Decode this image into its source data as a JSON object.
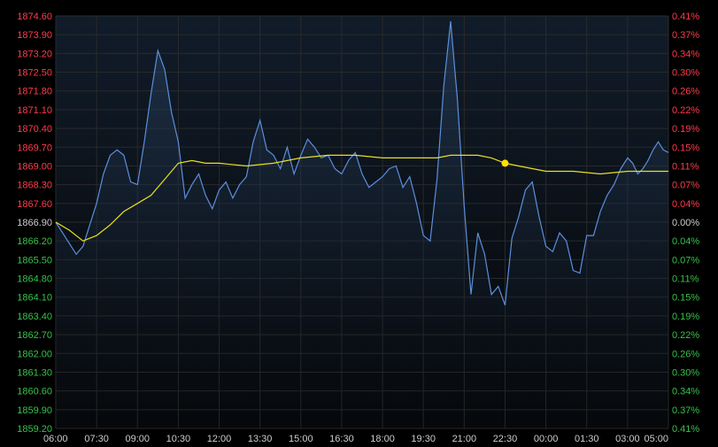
{
  "chart_data": {
    "type": "line",
    "title": "",
    "xlabel": "",
    "ylabel": "",
    "ylim": [
      1859.2,
      1874.6
    ],
    "reference_price": 1866.9,
    "grid": true,
    "legend": "none",
    "colors": {
      "background": "#000000",
      "plot_top": "#0f1b2b",
      "grid": "#2a2a2a",
      "up": "#ff3b4a",
      "down": "#35c24a",
      "neutral": "#cccccc",
      "price_line": "#5b8fdc",
      "avg_line": "#e8e020",
      "marker": "#ffe000",
      "xtick": "#cccccc"
    },
    "y_ticks_left": [
      "1874.60",
      "1873.90",
      "1873.20",
      "1872.50",
      "1871.80",
      "1871.10",
      "1870.40",
      "1869.70",
      "1869.00",
      "1868.30",
      "1867.60",
      "1866.90",
      "1866.20",
      "1865.50",
      "1864.80",
      "1864.10",
      "1863.40",
      "1862.70",
      "1862.00",
      "1861.30",
      "1860.60",
      "1859.90",
      "1859.20"
    ],
    "y_ticks_right": [
      "0.41%",
      "0.37%",
      "0.34%",
      "0.30%",
      "0.26%",
      "0.22%",
      "0.19%",
      "0.15%",
      "0.11%",
      "0.07%",
      "0.04%",
      "0.00%",
      "0.04%",
      "0.07%",
      "0.11%",
      "0.15%",
      "0.19%",
      "0.22%",
      "0.26%",
      "0.30%",
      "0.34%",
      "0.37%",
      "0.41%"
    ],
    "x_ticks": [
      "06:00",
      "07:30",
      "09:00",
      "10:30",
      "12:00",
      "13:30",
      "15:00",
      "16:30",
      "18:00",
      "19:30",
      "21:00",
      "22:30",
      "00:00",
      "01:30",
      "03:00",
      "05:00"
    ],
    "series": [
      {
        "x": [
          "06:00",
          "06:15",
          "06:30",
          "06:45",
          "07:00",
          "07:15",
          "07:30",
          "07:45",
          "08:00",
          "08:15",
          "08:30",
          "08:45",
          "09:00",
          "09:15",
          "09:30",
          "09:45",
          "10:00",
          "10:15",
          "10:30",
          "10:45",
          "11:00",
          "11:15",
          "11:30",
          "11:45",
          "12:00",
          "12:15",
          "12:30",
          "12:45",
          "13:00",
          "13:15",
          "13:30",
          "13:45",
          "14:00",
          "14:15",
          "14:30",
          "14:45",
          "15:00",
          "15:15",
          "15:30",
          "15:45",
          "16:00",
          "16:15",
          "16:30",
          "16:45",
          "17:00",
          "17:15",
          "17:30",
          "17:45",
          "18:00",
          "18:15",
          "18:30",
          "18:45",
          "19:00",
          "19:15",
          "19:30",
          "19:45",
          "20:00",
          "20:15",
          "20:30",
          "20:45",
          "21:00",
          "21:15",
          "21:30",
          "21:45",
          "22:00",
          "22:15",
          "22:30",
          "22:45",
          "23:00",
          "23:15",
          "23:30",
          "23:45",
          "00:00",
          "00:15",
          "00:30",
          "00:45",
          "01:00",
          "01:15",
          "01:30",
          "01:45",
          "02:00",
          "02:15",
          "02:30",
          "02:45",
          "03:00",
          "03:15",
          "03:30",
          "03:45",
          "04:00",
          "04:15",
          "04:30",
          "04:45",
          "05:00"
        ],
        "values": [
          1866.9,
          1866.5,
          1866.1,
          1865.7,
          1866.0,
          1866.8,
          1867.6,
          1868.7,
          1869.4,
          1869.6,
          1869.4,
          1868.4,
          1868.3,
          1869.9,
          1871.7,
          1873.3,
          1872.6,
          1871.0,
          1869.9,
          1867.8,
          1868.3,
          1868.7,
          1867.9,
          1867.4,
          1868.1,
          1868.4,
          1867.8,
          1868.3,
          1868.6,
          1869.9,
          1870.7,
          1869.6,
          1869.4,
          1868.9,
          1869.7,
          1868.7,
          1869.4,
          1870.0,
          1869.7,
          1869.3,
          1869.4,
          1868.9,
          1868.7,
          1869.2,
          1869.5,
          1868.7,
          1868.2,
          1868.4,
          1868.6,
          1868.9,
          1869.0,
          1868.2,
          1868.6,
          1867.6,
          1866.4,
          1866.2,
          1868.5,
          1872.0,
          1874.4,
          1871.5,
          1867.5,
          1864.2,
          1866.5,
          1865.7,
          1864.2,
          1864.5,
          1863.8,
          1866.3,
          1867.1,
          1868.1,
          1868.4,
          1867.1,
          1866.0,
          1865.8,
          1866.5,
          1866.2,
          1865.1,
          1865.0,
          1866.4,
          1866.4,
          1867.3,
          1867.9,
          1868.3,
          1868.9,
          1869.3,
          1869.1,
          1868.7,
          1868.9,
          1869.2,
          1869.6,
          1869.9,
          1869.6,
          1869.5
        ]
      },
      {
        "x": [
          "06:00",
          "06:30",
          "07:00",
          "07:30",
          "08:00",
          "08:30",
          "09:00",
          "09:30",
          "10:00",
          "10:30",
          "11:00",
          "11:30",
          "12:00",
          "13:00",
          "14:00",
          "15:00",
          "16:00",
          "17:00",
          "18:00",
          "19:00",
          "19:30",
          "20:00",
          "20:30",
          "21:00",
          "21:30",
          "22:00",
          "22:30",
          "23:00",
          "23:30",
          "00:00",
          "01:00",
          "02:00",
          "03:00",
          "04:00",
          "05:00"
        ],
        "values": [
          1866.9,
          1866.6,
          1866.2,
          1866.4,
          1866.8,
          1867.3,
          1867.6,
          1867.9,
          1868.5,
          1869.1,
          1869.2,
          1869.1,
          1869.1,
          1869.0,
          1869.1,
          1869.3,
          1869.4,
          1869.4,
          1869.3,
          1869.3,
          1869.3,
          1869.3,
          1869.4,
          1869.4,
          1869.4,
          1869.3,
          1869.1,
          1869.0,
          1868.9,
          1868.8,
          1868.8,
          1868.7,
          1868.8,
          1868.8,
          1868.8
        ]
      }
    ],
    "marker_point": {
      "x": "22:30",
      "y": 1869.1
    }
  }
}
